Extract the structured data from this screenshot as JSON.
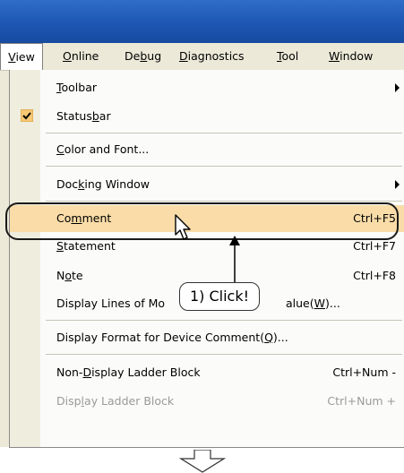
{
  "menubar": {
    "items": [
      {
        "label": "View"
      },
      {
        "label": "Online"
      },
      {
        "label": "Debug"
      },
      {
        "label": "Diagnostics"
      },
      {
        "label": "Tool"
      },
      {
        "label": "Window"
      }
    ]
  },
  "view_menu": {
    "items": [
      {
        "label": "Toolbar",
        "shortcut": ""
      },
      {
        "label": "Statusbar",
        "shortcut": "",
        "checked": true
      },
      {
        "label": "Color and Font...",
        "shortcut": ""
      },
      {
        "label": "Docking Window",
        "shortcut": ""
      },
      {
        "label": "Comment",
        "shortcut": "Ctrl+F5",
        "highlighted": true
      },
      {
        "label": "Statement",
        "shortcut": "Ctrl+F7"
      },
      {
        "label": "Note",
        "shortcut": "Ctrl+F8"
      },
      {
        "label": "Display Lines of Mo",
        "label_tail": "alue(W)...",
        "shortcut": ""
      },
      {
        "label": "Display Format for Device Comment(Q)...",
        "shortcut": ""
      },
      {
        "label": "Non-Display Ladder Block",
        "shortcut": "Ctrl+Num -"
      },
      {
        "label": "Display Ladder Block",
        "shortcut": "Ctrl+Num +",
        "disabled": true
      }
    ]
  },
  "annotation": {
    "callout_text": "1) Click!"
  }
}
